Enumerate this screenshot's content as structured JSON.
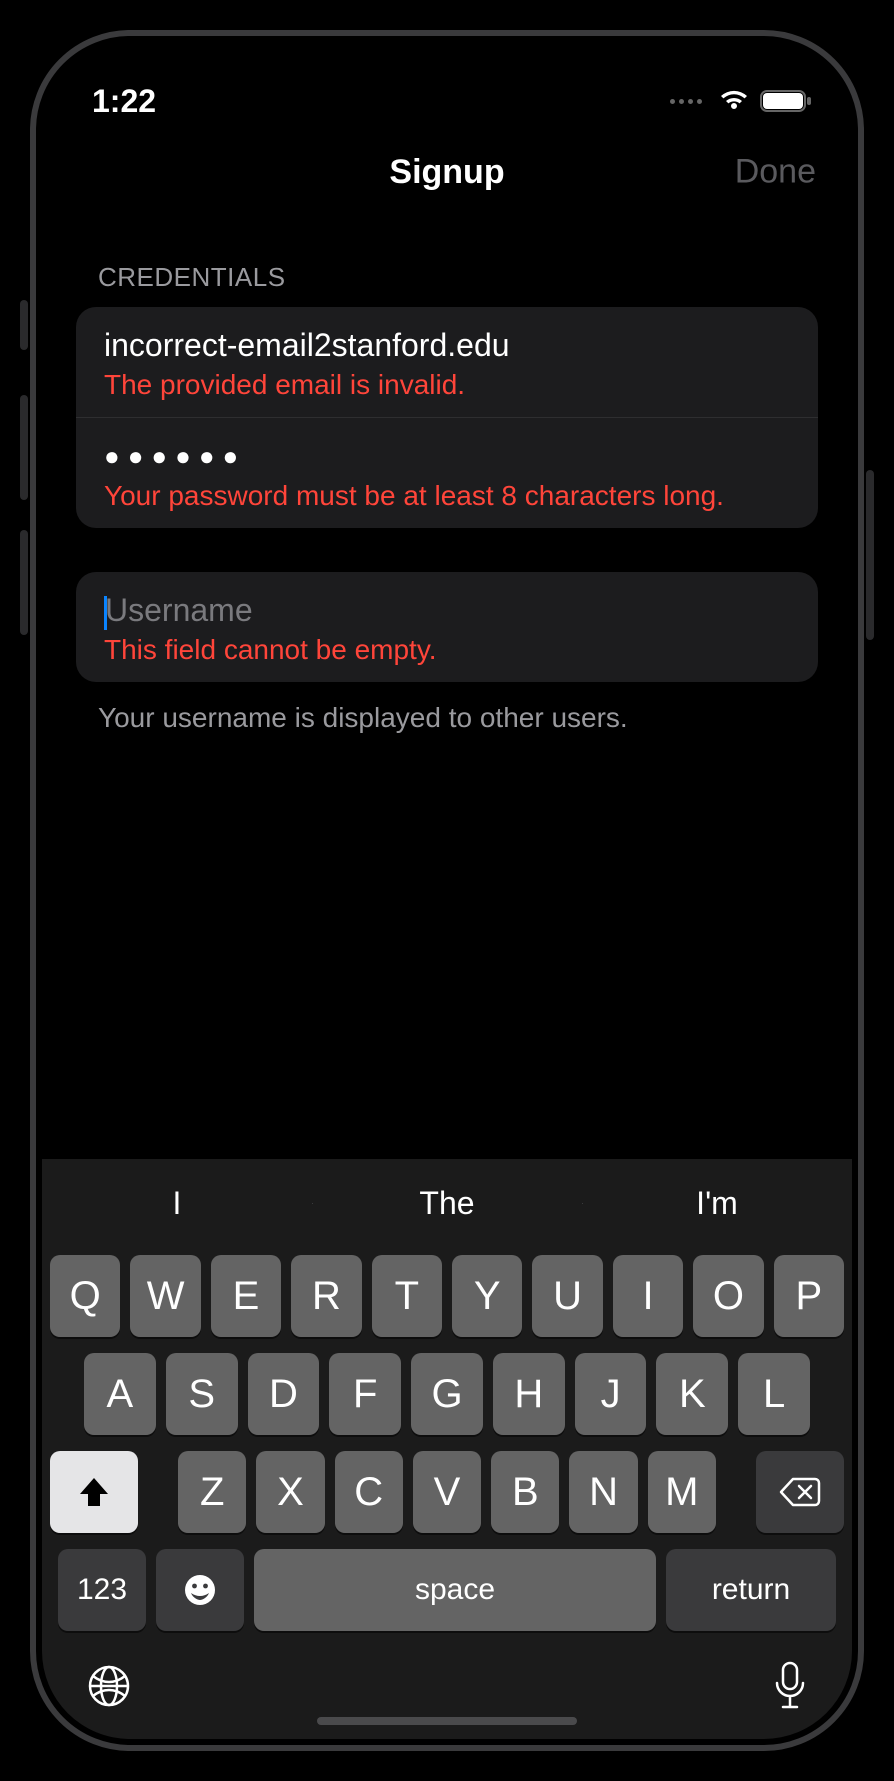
{
  "status": {
    "time": "1:22"
  },
  "nav": {
    "title": "Signup",
    "done_label": "Done"
  },
  "credentials": {
    "section_label": "CREDENTIALS",
    "email": {
      "value": "incorrect-email2stanford.edu",
      "error": "The provided email is invalid."
    },
    "password": {
      "value_masked": "●●●●●●",
      "error": "Your password must be at least 8 characters long."
    }
  },
  "username": {
    "placeholder": "Username",
    "value": "",
    "error": "This field cannot be empty.",
    "footer": "Your username is displayed to other users."
  },
  "keyboard": {
    "predictions": [
      "I",
      "The",
      "I'm"
    ],
    "row1": [
      "Q",
      "W",
      "E",
      "R",
      "T",
      "Y",
      "U",
      "I",
      "O",
      "P"
    ],
    "row2": [
      "A",
      "S",
      "D",
      "F",
      "G",
      "H",
      "J",
      "K",
      "L"
    ],
    "row3": [
      "Z",
      "X",
      "C",
      "V",
      "B",
      "N",
      "M"
    ],
    "k123": "123",
    "space": "space",
    "return": "return"
  }
}
